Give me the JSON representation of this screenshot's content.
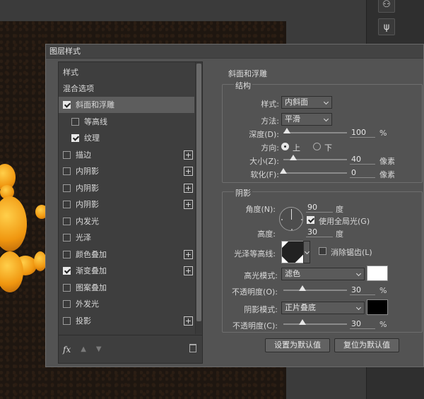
{
  "dialog_title": "图层样式",
  "left_panel": {
    "header": "样式",
    "blend": "混合选项",
    "items": [
      {
        "label": "斜面和浮雕",
        "checked": true,
        "selected": true,
        "indent": false,
        "plus": false
      },
      {
        "label": "等高线",
        "checked": false,
        "selected": false,
        "indent": true,
        "plus": false
      },
      {
        "label": "纹理",
        "checked": true,
        "selected": false,
        "indent": true,
        "plus": false
      },
      {
        "label": "描边",
        "checked": false,
        "selected": false,
        "indent": false,
        "plus": true
      },
      {
        "label": "内阴影",
        "checked": false,
        "selected": false,
        "indent": false,
        "plus": true
      },
      {
        "label": "内阴影",
        "checked": false,
        "selected": false,
        "indent": false,
        "plus": true
      },
      {
        "label": "内阴影",
        "checked": false,
        "selected": false,
        "indent": false,
        "plus": true
      },
      {
        "label": "内发光",
        "checked": false,
        "selected": false,
        "indent": false,
        "plus": false
      },
      {
        "label": "光泽",
        "checked": false,
        "selected": false,
        "indent": false,
        "plus": false
      },
      {
        "label": "颜色叠加",
        "checked": false,
        "selected": false,
        "indent": false,
        "plus": true
      },
      {
        "label": "渐变叠加",
        "checked": true,
        "selected": false,
        "indent": false,
        "plus": true
      },
      {
        "label": "图案叠加",
        "checked": false,
        "selected": false,
        "indent": false,
        "plus": false
      },
      {
        "label": "外发光",
        "checked": false,
        "selected": false,
        "indent": false,
        "plus": false
      },
      {
        "label": "投影",
        "checked": false,
        "selected": false,
        "indent": false,
        "plus": true
      }
    ],
    "footer_fx": "fx"
  },
  "bevel": {
    "title": "斜面和浮雕",
    "structure_title": "结构",
    "style_label": "样式:",
    "style_value": "内斜面",
    "technique_label": "方法:",
    "technique_value": "平滑",
    "depth_label": "深度(D):",
    "depth_value": "100",
    "depth_unit": "%",
    "depth_level": 0.05,
    "direction_label": "方向:",
    "dir_up": "上",
    "dir_down": "下",
    "size_label": "大小(Z):",
    "size_value": "40",
    "size_unit": "像素",
    "size_level": 0.16,
    "soften_label": "软化(F):",
    "soften_value": "0",
    "soften_unit": "像素",
    "soften_level": 0.0
  },
  "shading": {
    "title": "阴影",
    "angle_label": "角度(N):",
    "angle_value": "90",
    "angle_unit": "度",
    "global_light_label": "使用全局光(G)",
    "altitude_label": "高度:",
    "altitude_value": "30",
    "altitude_unit": "度",
    "gloss_label": "光泽等高线:",
    "antialias_label": "消除锯齿(L)",
    "highlight_label": "高光模式:",
    "highlight_value": "滤色",
    "highlight_color": "#ffffff",
    "opacity1_label": "不透明度(O):",
    "opacity1_value": "30",
    "opacity1_unit": "%",
    "opacity1_level": 0.3,
    "shadow_label": "阴影模式:",
    "shadow_value": "正片叠底",
    "shadow_color": "#000000",
    "opacity2_label": "不透明度(C):",
    "opacity2_value": "30",
    "opacity2_unit": "%",
    "opacity2_level": 0.3
  },
  "buttons": {
    "make_default": "设置为默认值",
    "reset_default": "复位为默认值"
  }
}
